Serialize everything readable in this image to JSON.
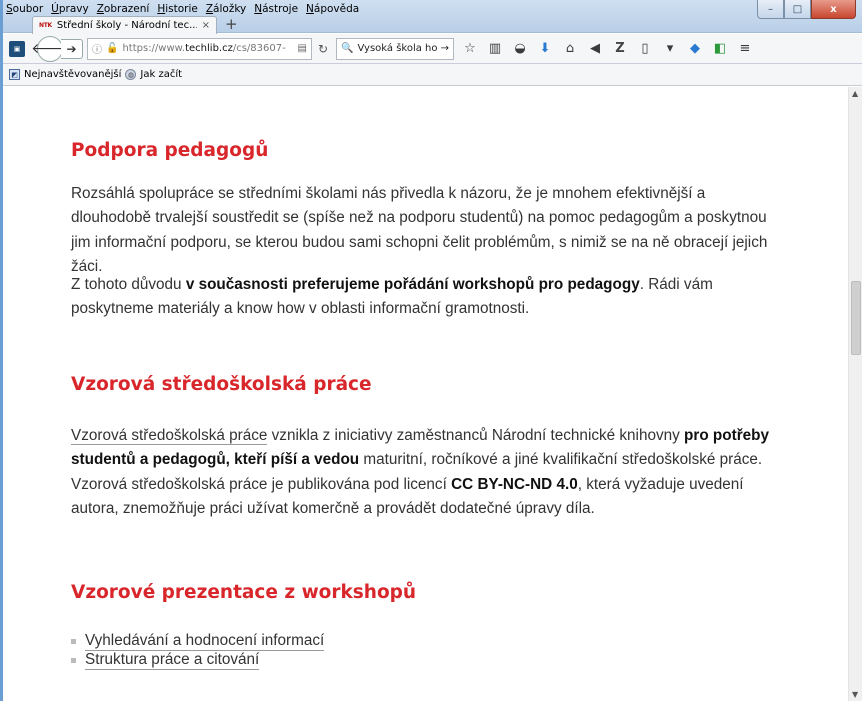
{
  "menu": [
    "Soubor",
    "Úpravy",
    "Zobrazení",
    "Historie",
    "Záložky",
    "Nástroje",
    "Nápověda"
  ],
  "tab": {
    "favicon": "NTK",
    "title": "Střední školy - Národní tec...",
    "close": "×"
  },
  "newtab": "+",
  "window": {
    "minimize": "–",
    "maximize": "□",
    "close": "x"
  },
  "nav": {
    "url_prefix": "https://www.",
    "url_domain": "techlib.cz",
    "url_path": "/cs/83607-",
    "search_value": "Vysoká škola hot"
  },
  "bookmarks": [
    "Nejnavštěvovanější",
    "Jak začít"
  ],
  "content": {
    "h1": "Podpora pedagogů",
    "p1": "Rozsáhlá spolupráce se středními školami nás přivedla k názoru, že je mnohem efektivnější a dlouhodobě trvalejší soustředit se (spíše než na podporu studentů) na pomoc pedagogům a poskytnou jim informační podporu, se kterou budou sami schopni čelit problémům, s nimiž se na ně obracejí jejich žáci.",
    "p2_a": "Z tohoto důvodu ",
    "p2_b": "v současnosti preferujeme pořádání workshopů pro pedagogy",
    "p2_c": ". Rádi vám poskytneme materiály a know how v oblasti informační gramotnosti.",
    "h2": "Vzorová středoškolská práce",
    "p3_link": "Vzorová středoškolská práce",
    "p3_a": " vznikla z iniciativy zaměstnanců Národní technické knihovny ",
    "p3_b": "pro potřeby studentů a pedagogů, kteří píší a vedou",
    "p3_c": " maturitní, ročníkové a jiné kvalifikační středoškolské práce. Vzorová středoškolská práce je publikována pod licencí ",
    "p3_d": "CC BY-NC-ND 4.0",
    "p3_e": ", která vyžaduje uvedení autora, znemožňuje práci užívat komerčně a provádět dodatečné úpravy díla.",
    "h3": "Vzorové prezentace z workshopů",
    "links": [
      "Vyhledávání a hodnocení informací",
      "Struktura práce a citování"
    ]
  }
}
